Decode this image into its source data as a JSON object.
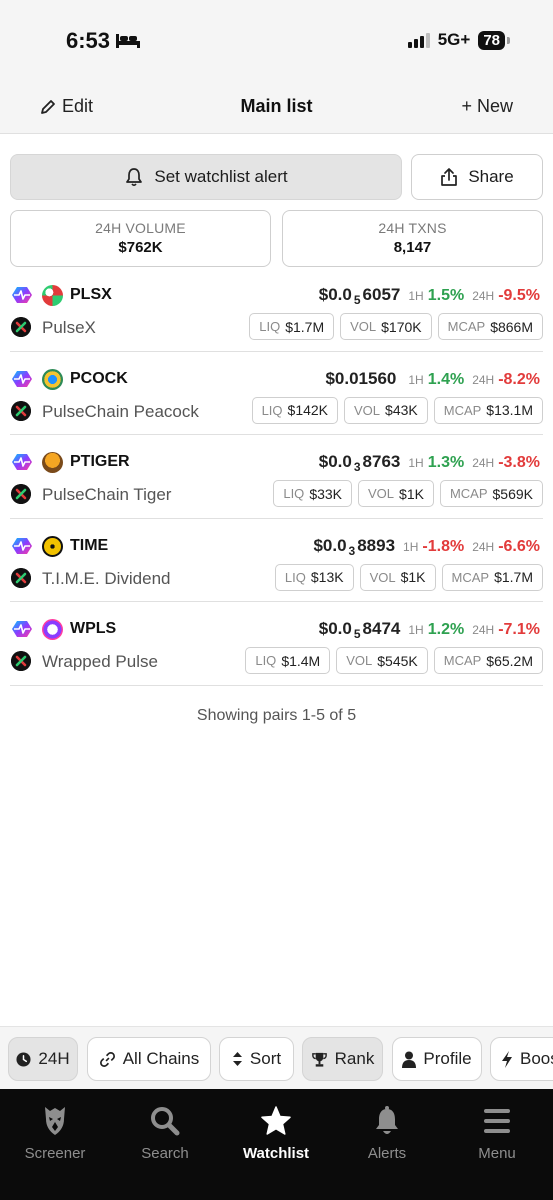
{
  "status": {
    "time": "6:53",
    "network": "5G+",
    "battery": "78"
  },
  "nav": {
    "edit_label": "Edit",
    "title": "Main list",
    "new_label": "+ New"
  },
  "actions": {
    "alert_label": "Set watchlist alert",
    "share_label": "Share"
  },
  "stats": {
    "volume_label": "24H VOLUME",
    "volume_value": "$762K",
    "txns_label": "24H TXNS",
    "txns_value": "8,147"
  },
  "labels": {
    "h1": "1H",
    "h24": "24H",
    "liq": "LIQ",
    "vol": "VOL",
    "mcap": "MCAP"
  },
  "pairs": [
    {
      "symbol": "PLSX",
      "name": "PulseX",
      "price_prefix": "$0.0",
      "price_zeros": "5",
      "price_digits": "6057",
      "h1": "1.5%",
      "h1_dir": "pos",
      "h24": "-9.5%",
      "h24_dir": "neg",
      "liq": "$1.7M",
      "vol": "$170K",
      "mcap": "$866M",
      "icon": "pulsex-icon"
    },
    {
      "symbol": "PCOCK",
      "name": "PulseChain Peacock",
      "price_prefix": "$0.01560",
      "price_zeros": "",
      "price_digits": "",
      "h1": "1.4%",
      "h1_dir": "pos",
      "h24": "-8.2%",
      "h24_dir": "neg",
      "liq": "$142K",
      "vol": "$43K",
      "mcap": "$13.1M",
      "icon": "peacock-icon"
    },
    {
      "symbol": "PTIGER",
      "name": "PulseChain Tiger",
      "price_prefix": "$0.0",
      "price_zeros": "3",
      "price_digits": "8763",
      "h1": "1.3%",
      "h1_dir": "pos",
      "h24": "-3.8%",
      "h24_dir": "neg",
      "liq": "$33K",
      "vol": "$1K",
      "mcap": "$569K",
      "icon": "tiger-icon"
    },
    {
      "symbol": "TIME",
      "name": "T.I.M.E. Dividend",
      "price_prefix": "$0.0",
      "price_zeros": "3",
      "price_digits": "8893",
      "h1": "-1.8%",
      "h1_dir": "neg",
      "h24": "-6.6%",
      "h24_dir": "neg",
      "liq": "$13K",
      "vol": "$1K",
      "mcap": "$1.7M",
      "icon": "clock-icon"
    },
    {
      "symbol": "WPLS",
      "name": "Wrapped Pulse",
      "price_prefix": "$0.0",
      "price_zeros": "5",
      "price_digits": "8474",
      "h1": "1.2%",
      "h1_dir": "pos",
      "h24": "-7.1%",
      "h24_dir": "neg",
      "liq": "$1.4M",
      "vol": "$545K",
      "mcap": "$65.2M",
      "icon": "wrapped-pulse-icon"
    }
  ],
  "showing": "Showing pairs 1-5 of 5",
  "filters": {
    "timeframe": "24H",
    "chains": "All Chains",
    "sort": "Sort",
    "rank": "Rank",
    "profile": "Profile",
    "boost": "Boos"
  },
  "tabs": {
    "screener": "Screener",
    "search": "Search",
    "watchlist": "Watchlist",
    "alerts": "Alerts",
    "menu": "Menu"
  },
  "colors": {
    "positive": "#2ea150",
    "negative": "#e23b3b",
    "tabbar": "#0b0b0b"
  }
}
